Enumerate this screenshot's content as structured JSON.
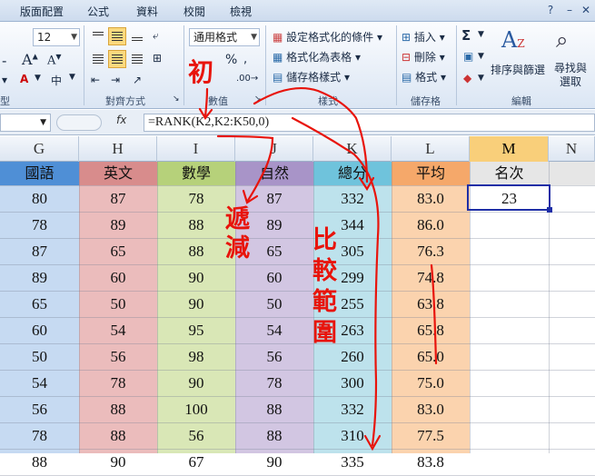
{
  "tabs": [
    "版面配置",
    "公式",
    "資料",
    "校閱",
    "檢視"
  ],
  "ribbon": {
    "font_size": "12",
    "number_format": "通用格式",
    "percent": "%",
    "groups": {
      "align": "對齊方式",
      "number": "數值",
      "styles": "樣式",
      "cells": "儲存格",
      "edit": "編輯",
      "left_partial": "型"
    },
    "styles_items": [
      "設定格式化的條件",
      "格式化為表格",
      "儲存格樣式"
    ],
    "cells_items": [
      "插入",
      "刪除",
      "格式"
    ],
    "edit_items": {
      "sort": "排序與篩選",
      "find": "尋找與選取",
      "sigma": "Σ"
    }
  },
  "formula_bar": {
    "fx": "fx",
    "formula": "=RANK(K2,K2:K50,0)"
  },
  "columns": [
    {
      "id": "G",
      "header": "國語",
      "color": "#c6daf2",
      "hdr_color": "#4f8fd6"
    },
    {
      "id": "H",
      "header": "英文",
      "color": "#ebbcbc",
      "hdr_color": "#d88c8c"
    },
    {
      "id": "I",
      "header": "數學",
      "color": "#d9e7b6",
      "hdr_color": "#b6d17a"
    },
    {
      "id": "J",
      "header": "自然",
      "color": "#d2c6e2",
      "hdr_color": "#a894c8"
    },
    {
      "id": "K",
      "header": "總分",
      "color": "#bde2ec",
      "hdr_color": "#6fc3dc"
    },
    {
      "id": "L",
      "header": "平均",
      "color": "#fbd3ae",
      "hdr_color": "#f5a86a"
    },
    {
      "id": "M",
      "header": "名次",
      "color": "#ffffff",
      "hdr_color": "#e6e6e6"
    },
    {
      "id": "N",
      "header": "",
      "color": "#ffffff",
      "hdr_color": "#e6e6e6"
    }
  ],
  "rows": [
    [
      "80",
      "87",
      "78",
      "87",
      "332",
      "83.0",
      "23"
    ],
    [
      "78",
      "89",
      "88",
      "89",
      "344",
      "86.0",
      ""
    ],
    [
      "87",
      "65",
      "88",
      "65",
      "305",
      "76.3",
      ""
    ],
    [
      "89",
      "60",
      "90",
      "60",
      "299",
      "74.8",
      ""
    ],
    [
      "65",
      "50",
      "90",
      "50",
      "255",
      "63.8",
      ""
    ],
    [
      "60",
      "54",
      "95",
      "54",
      "263",
      "65.8",
      ""
    ],
    [
      "50",
      "56",
      "98",
      "56",
      "260",
      "65.0",
      ""
    ],
    [
      "54",
      "78",
      "90",
      "78",
      "300",
      "75.0",
      ""
    ],
    [
      "56",
      "88",
      "100",
      "88",
      "332",
      "83.0",
      ""
    ],
    [
      "78",
      "88",
      "56",
      "88",
      "310",
      "77.5",
      ""
    ],
    [
      "88",
      "90",
      "67",
      "90",
      "335",
      "83.8",
      ""
    ]
  ],
  "annotations": {
    "initial": "初",
    "decrement": "遞減",
    "compare_range": "比較範圍"
  },
  "annotation_color": "#e8140c"
}
